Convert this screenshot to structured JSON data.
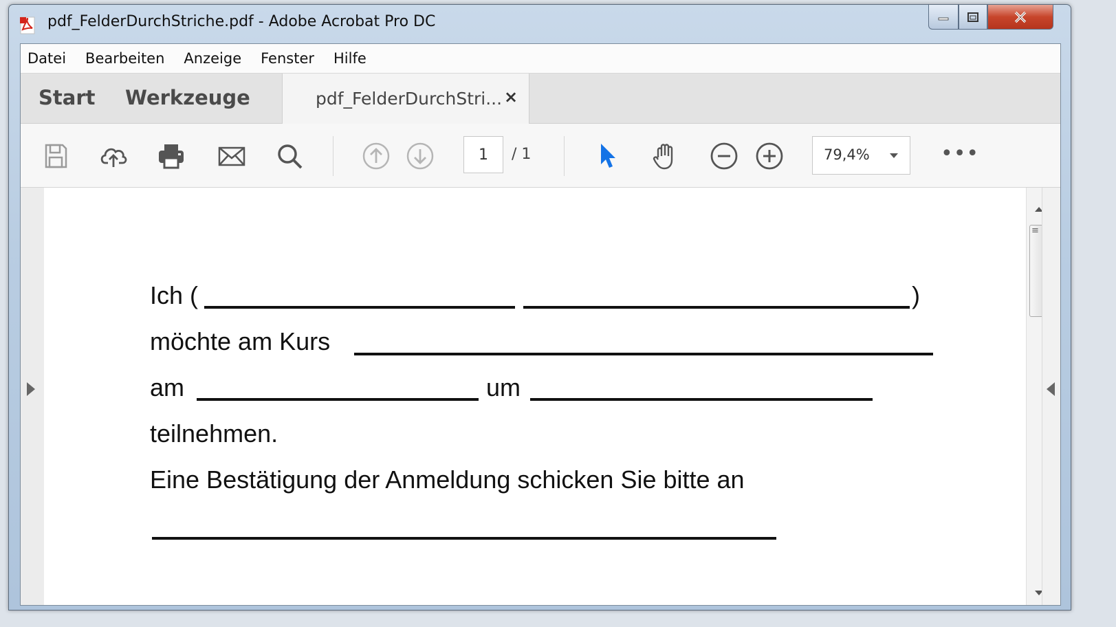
{
  "window": {
    "title": "pdf_FelderDurchStriche.pdf - Adobe Acrobat Pro DC"
  },
  "menu": [
    "Datei",
    "Bearbeiten",
    "Anzeige",
    "Fenster",
    "Hilfe"
  ],
  "tabs": {
    "start": "Start",
    "werkzeuge": "Werkzeuge",
    "document": "pdf_FelderDurchStri...",
    "close": "×"
  },
  "toolbar": {
    "icons": [
      "save-icon",
      "upload-cloud-icon",
      "print-icon",
      "email-icon",
      "search-icon",
      "previous-page-icon",
      "next-page-icon",
      "select-pointer-icon",
      "hand-icon",
      "zoom-out-icon",
      "zoom-in-icon",
      "more-icon"
    ],
    "page_current": "1",
    "page_total": "/ 1",
    "zoom": "79,4%",
    "more": "•••"
  },
  "document": {
    "line1_prefix": "Ich (",
    "line1_suffix": ")",
    "line2_prefix": "möchte am Kurs",
    "line3_am": "am",
    "line3_um": "um",
    "line4": "teilnehmen.",
    "line5": "Eine Bestätigung der Anmeldung schicken Sie bitte an"
  },
  "colors": {
    "pointer_active": "#1473e6",
    "close_button": "#c7452b"
  }
}
